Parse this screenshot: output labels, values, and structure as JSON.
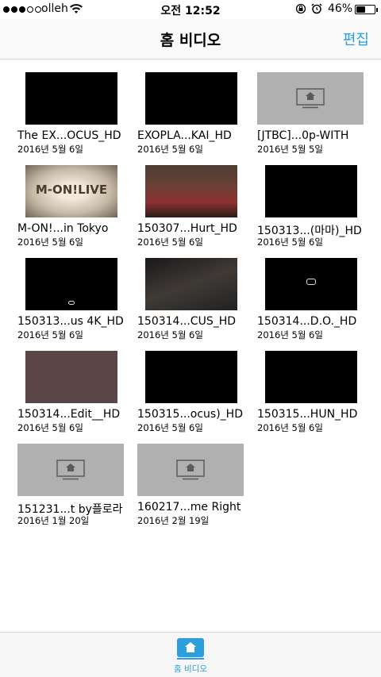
{
  "status": {
    "carrier": "olleh",
    "time": "오전 12:52",
    "battery": "46%",
    "battery_level": 0.46,
    "signal_bars": 3,
    "signal_total": 5,
    "icons": [
      "wifi-icon",
      "orientation-lock-icon",
      "alarm-icon",
      "battery-icon"
    ]
  },
  "nav": {
    "title": "홈 비디오",
    "edit_label": "편집"
  },
  "videos": [
    {
      "title": "The EX...OCUS_HD",
      "date": "2016년 5월 6일",
      "thumb": "video"
    },
    {
      "title": "EXOPLA...KAI_HD",
      "date": "2016년 5월 6일",
      "thumb": "video"
    },
    {
      "title": "[JTBC]...0p-WITH",
      "date": "2016년 5월 5일",
      "thumb": "placeholder"
    },
    {
      "title": "M-ON!...in Tokyo",
      "date": "2016년 5월 6일",
      "thumb": "mon",
      "thumb_text": "M-ON!LIVE"
    },
    {
      "title": "150307...Hurt_HD",
      "date": "2016년 5월 6일",
      "thumb": "stage"
    },
    {
      "title": "150313...(마마)_HD",
      "date": "2016년 5월 6일",
      "thumb": "video"
    },
    {
      "title": "150313...us 4K_HD",
      "date": "2016년 5월 6일",
      "thumb": "video"
    },
    {
      "title": "150314...CUS_HD",
      "date": "2016년 5월 6일",
      "thumb": "dark-stage"
    },
    {
      "title": "150314...D.O._HD",
      "date": "2016년 5월 6일",
      "thumb": "video"
    },
    {
      "title": "150314...Edit__HD",
      "date": "2016년 5월 6일",
      "thumb": "brown"
    },
    {
      "title": "150315...ocus)_HD",
      "date": "2016년 5월 6일",
      "thumb": "video"
    },
    {
      "title": "150315...HUN_HD",
      "date": "2016년 5월 6일",
      "thumb": "video"
    },
    {
      "title": "151231...t by플로라",
      "date": "2016년 1월 20일",
      "thumb": "placeholder"
    },
    {
      "title": "160217...me Right",
      "date": "2016년 2월 19일",
      "thumb": "placeholder"
    }
  ],
  "tab_bar": {
    "home_label": "홈 비디오",
    "home_icon": "home-video-icon"
  },
  "colors": {
    "accent": "#2d9fdc",
    "placeholder": "#b0b0b0"
  }
}
